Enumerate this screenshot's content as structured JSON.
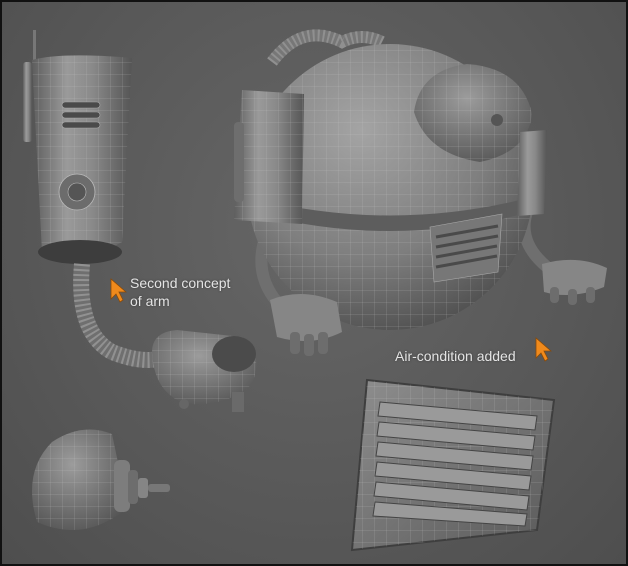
{
  "annotations": {
    "arm_concept_line1": "Second concept",
    "arm_concept_line2": "of arm",
    "air_condition": "Air-condition added"
  },
  "icons": {
    "arm_pointer": "orange-arrow-cursor-icon",
    "air_pointer": "orange-arrow-cursor-icon"
  },
  "colors": {
    "background": "#5a5a5a",
    "model_gray": "#8a8a8a",
    "wire": "#c9c9c9",
    "label_text": "#e4e4e4",
    "cursor_orange": "#f08a1c"
  }
}
